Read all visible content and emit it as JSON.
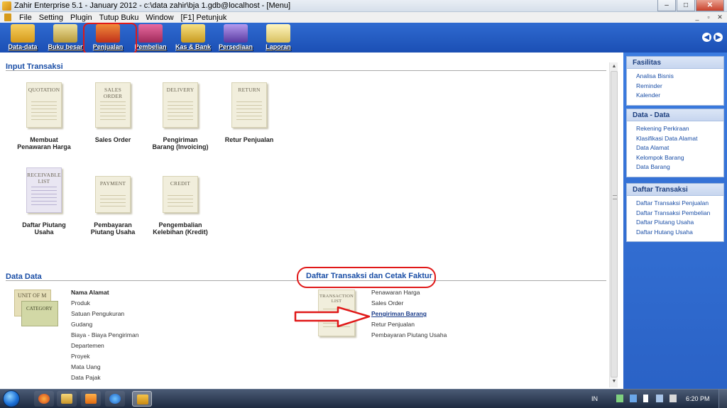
{
  "window": {
    "title": "Zahir Enterprise 5.1 - January 2012 - c:\\data zahir\\bja 1.gdb@localhost - [Menu]",
    "minimize": "–",
    "maximize": "□",
    "close": "✕"
  },
  "menubar": {
    "items": [
      "File",
      "Setting",
      "Plugin",
      "Tutup Buku",
      "Window",
      "[F1] Petunjuk"
    ],
    "mdi_minimize": "_",
    "mdi_restore": "▫",
    "mdi_close": "✕"
  },
  "toolbar": {
    "items": [
      {
        "label": "Data-data",
        "icon": "data-data-icon",
        "color": "#e8b020"
      },
      {
        "label": "Buku besar",
        "icon": "ledger-icon",
        "color": "#d9c46a"
      },
      {
        "label": "Penjualan",
        "icon": "sales-icon",
        "color": "#d94a2a"
      },
      {
        "label": "Pembelian",
        "icon": "purchase-icon",
        "color": "#c43a6a"
      },
      {
        "label": "Kas & Bank",
        "icon": "cash-bank-icon",
        "color": "#e8c040"
      },
      {
        "label": "Persediaan",
        "icon": "inventory-icon",
        "color": "#8a6ad0"
      },
      {
        "label": "Laporan",
        "icon": "report-icon",
        "color": "#f0e08a"
      }
    ],
    "prev": "◀",
    "next": "▶"
  },
  "input_transaksi": {
    "title": "Input Transaksi",
    "tiles": [
      {
        "doc_title": "QUOTATION",
        "label": "Membuat Penawaran Harga",
        "style": "normal"
      },
      {
        "doc_title": "SALES ORDER",
        "label": "Sales Order",
        "style": "normal"
      },
      {
        "doc_title": "DELIVERY",
        "label": "Pengiriman Barang (Invoicing)",
        "style": "normal"
      },
      {
        "doc_title": "RETURN",
        "label": "Retur Penjualan",
        "style": "normal"
      },
      {
        "doc_title": "RECEIVABLE LIST",
        "label": "Daftar Piutang Usaha",
        "style": "purple"
      },
      {
        "doc_title": "PAYMENT",
        "label": "Pembayaran Piutang Usaha",
        "style": "normal"
      },
      {
        "doc_title": "CREDIT",
        "label": "Pengembalian Kelebihan (Kredit)",
        "style": "normal"
      }
    ]
  },
  "data_data": {
    "title": "Data Data",
    "card_unit": "UNIT OF M",
    "card_category": "CATEGORY",
    "links": [
      "Nama Alamat",
      "Produk",
      "Satuan Pengukuran",
      "Gudang",
      "Biaya - Biaya Pengiriman",
      "Departemen",
      "Proyek",
      "Mata Uang",
      "Data Pajak"
    ]
  },
  "daftar_transaksi": {
    "title": "Daftar Transaksi dan Cetak Faktur",
    "doc_title": "TRANSACTION LIST",
    "links": [
      "Penawaran Harga",
      "Sales Order",
      "Pengiriman Barang",
      "Retur Penjualan",
      "Pembayaran Piutang Usaha"
    ],
    "active_index": 2,
    "highlight_color": "#e01818"
  },
  "right_panel": {
    "fasilitas": {
      "title": "Fasilitas",
      "links": [
        "Analisa Bisnis",
        "Reminder",
        "Kalender"
      ]
    },
    "data_data": {
      "title": "Data - Data",
      "links": [
        "Rekening Perkiraan",
        "Klasifikasi Data Alamat",
        "Data Alamat",
        "Kelompok Barang",
        "Data Barang"
      ]
    },
    "daftar_transaksi": {
      "title": "Daftar Transaksi",
      "links": [
        "Daftar Transaksi Penjualan",
        "Daftar Transaksi Pembelian",
        "Daftar Piutang Usaha",
        "Daftar Hutang Usaha"
      ]
    }
  },
  "taskbar": {
    "language": "IN",
    "time": "6:20 PM"
  }
}
